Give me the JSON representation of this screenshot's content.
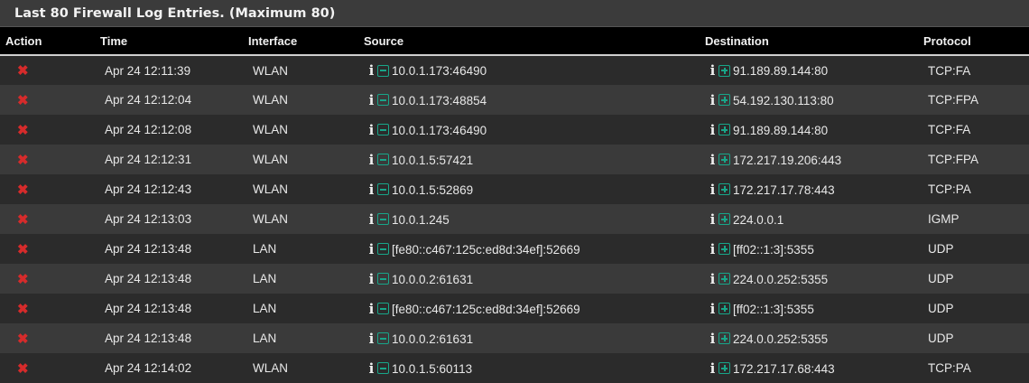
{
  "panel": {
    "title": "Last 80 Firewall Log Entries. (Maximum 80)"
  },
  "columns": {
    "action": "Action",
    "time": "Time",
    "interface": "Interface",
    "source": "Source",
    "destination": "Destination",
    "protocol": "Protocol"
  },
  "icons": {
    "action": "block-x-icon",
    "info": "info-icon",
    "source_action": "remove-rule-minus-icon",
    "destination_action": "add-rule-plus-icon"
  },
  "colors": {
    "block": "#d62b2b",
    "rule_icon": "#18a689"
  },
  "rows": [
    {
      "time": "Apr 24 12:11:39",
      "interface": "WLAN",
      "source": "10.0.1.173:46490",
      "destination": "91.189.89.144:80",
      "protocol": "TCP:FA"
    },
    {
      "time": "Apr 24 12:12:04",
      "interface": "WLAN",
      "source": "10.0.1.173:48854",
      "destination": "54.192.130.113:80",
      "protocol": "TCP:FPA"
    },
    {
      "time": "Apr 24 12:12:08",
      "interface": "WLAN",
      "source": "10.0.1.173:46490",
      "destination": "91.189.89.144:80",
      "protocol": "TCP:FA"
    },
    {
      "time": "Apr 24 12:12:31",
      "interface": "WLAN",
      "source": "10.0.1.5:57421",
      "destination": "172.217.19.206:443",
      "protocol": "TCP:FPA"
    },
    {
      "time": "Apr 24 12:12:43",
      "interface": "WLAN",
      "source": "10.0.1.5:52869",
      "destination": "172.217.17.78:443",
      "protocol": "TCP:PA"
    },
    {
      "time": "Apr 24 12:13:03",
      "interface": "WLAN",
      "source": "10.0.1.245",
      "destination": "224.0.0.1",
      "protocol": "IGMP"
    },
    {
      "time": "Apr 24 12:13:48",
      "interface": "LAN",
      "source": "[fe80::c467:125c:ed8d:34ef]:52669",
      "destination": "[ff02::1:3]:5355",
      "protocol": "UDP"
    },
    {
      "time": "Apr 24 12:13:48",
      "interface": "LAN",
      "source": "10.0.0.2:61631",
      "destination": "224.0.0.252:5355",
      "protocol": "UDP"
    },
    {
      "time": "Apr 24 12:13:48",
      "interface": "LAN",
      "source": "[fe80::c467:125c:ed8d:34ef]:52669",
      "destination": "[ff02::1:3]:5355",
      "protocol": "UDP"
    },
    {
      "time": "Apr 24 12:13:48",
      "interface": "LAN",
      "source": "10.0.0.2:61631",
      "destination": "224.0.0.252:5355",
      "protocol": "UDP"
    },
    {
      "time": "Apr 24 12:14:02",
      "interface": "WLAN",
      "source": "10.0.1.5:60113",
      "destination": "172.217.17.68:443",
      "protocol": "TCP:PA"
    }
  ]
}
